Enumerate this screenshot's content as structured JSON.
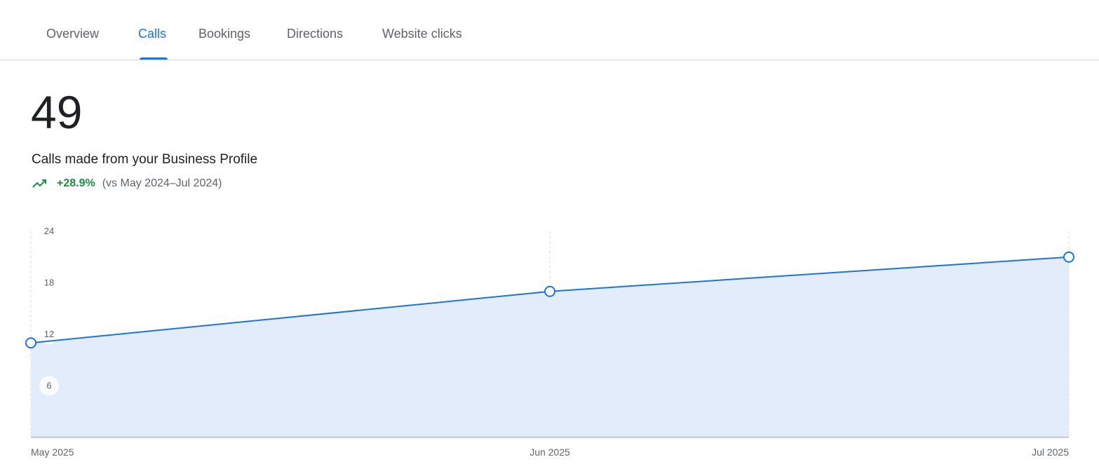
{
  "tabs": [
    {
      "label": "Overview",
      "active": false
    },
    {
      "label": "Calls",
      "active": true
    },
    {
      "label": "Bookings",
      "active": false
    },
    {
      "label": "Directions",
      "active": false
    },
    {
      "label": "Website clicks",
      "active": false
    }
  ],
  "metric": {
    "value": "49",
    "label": "Calls made from your Business Profile",
    "trend_icon": "trending-up-icon",
    "change": "+28.9%",
    "comparison": "(vs May 2024–Jul 2024)"
  },
  "colors": {
    "accent": "#1a73e8",
    "positive": "#1e8e3e",
    "area_fill": "#e3ecfb",
    "muted_text": "#5f6368"
  },
  "chart_data": {
    "type": "area",
    "x": [
      "May 2025",
      "Jun 2025",
      "Jul 2025"
    ],
    "series": [
      {
        "values": [
          11,
          17,
          21
        ]
      }
    ],
    "y_ticks": [
      6,
      12,
      18,
      24
    ],
    "ylim": [
      0,
      24
    ],
    "grid": "vertical dashed",
    "legend": "none"
  }
}
